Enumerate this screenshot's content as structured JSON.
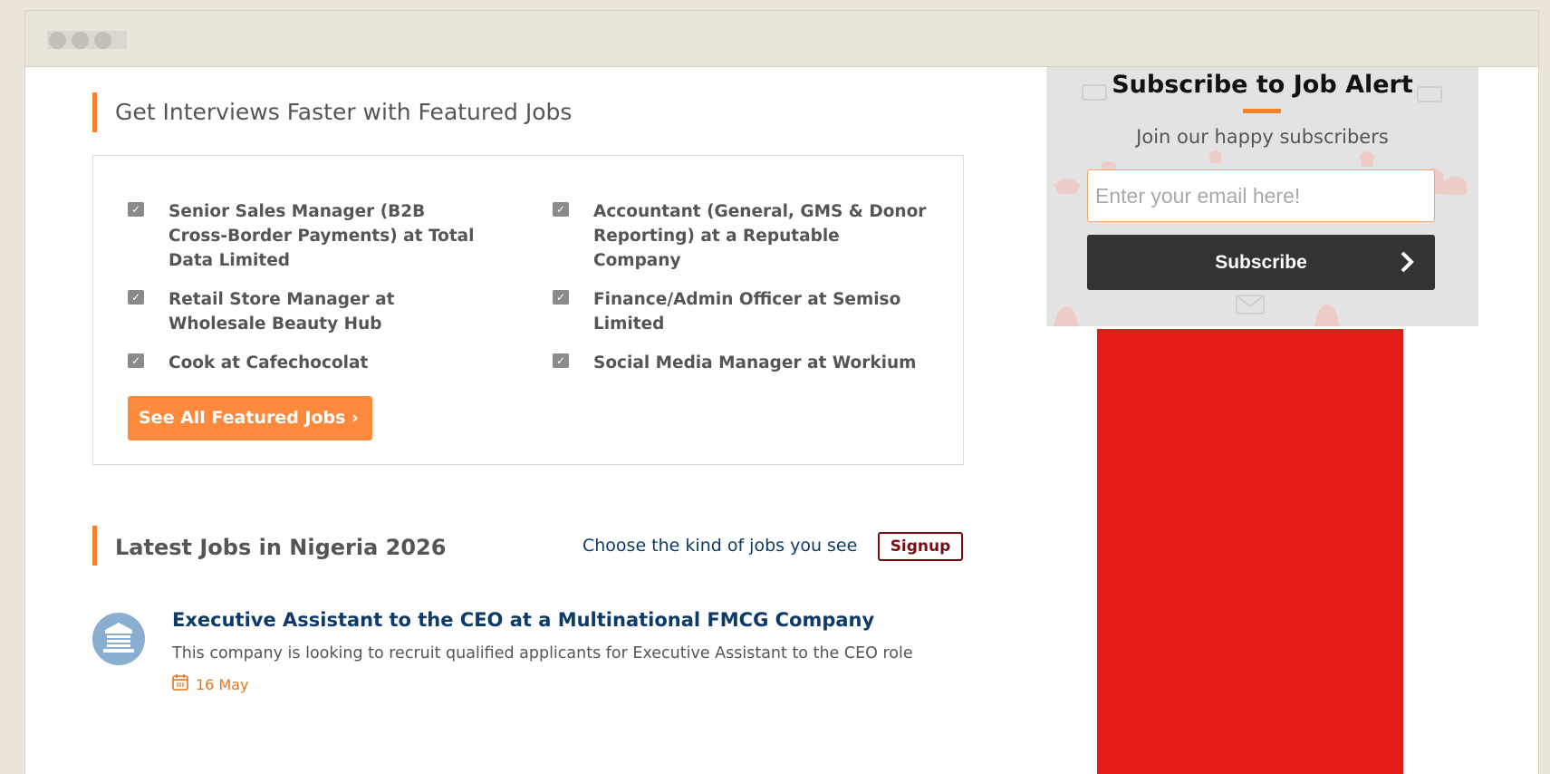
{
  "featured": {
    "heading": "Get Interviews Faster with Featured Jobs",
    "jobs": [
      "Senior Sales Manager (B2B Cross-Border Payments) at Total Data Limited",
      "Accountant (General, GMS & Donor Reporting) at a Reputable Company",
      "Retail Store Manager at Wholesale Beauty Hub",
      "Finance/Admin Officer at Semiso Limited",
      "Cook at Cafechocolat",
      "Social Media Manager at Workium"
    ],
    "cta_label": "See All Featured Jobs ›"
  },
  "latest": {
    "heading": "Latest Jobs in Nigeria 2026",
    "choose_text": "Choose the kind of jobs you see",
    "signup_label": "Signup",
    "listing": {
      "title": "Executive Assistant to the CEO at a Multinational FMCG Company",
      "description": "This company is looking to recruit qualified applicants for Executive Assistant to the CEO role",
      "date": "16 May",
      "icon": "building-icon",
      "date_icon": "calendar-icon"
    }
  },
  "subscribe": {
    "title": "Subscribe to Job Alert",
    "subtitle": "Join our happy subscribers",
    "email_placeholder": "Enter your email here!",
    "button_label": "Subscribe",
    "button_icon": "chevron-right-icon"
  },
  "colors": {
    "accent": "#f5822a",
    "cta": "#fd8a3c",
    "link": "#0d3a66",
    "signup": "#7a0c11",
    "ad": "#e41b17"
  }
}
